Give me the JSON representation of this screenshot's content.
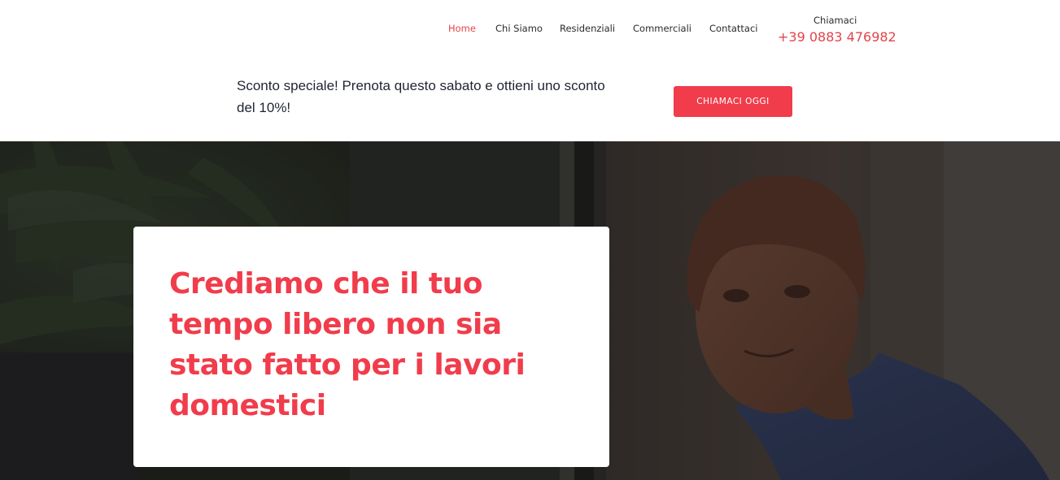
{
  "nav": {
    "items": [
      {
        "label": "Home"
      },
      {
        "label": "Chi Siamo"
      },
      {
        "label": "Residenziali"
      },
      {
        "label": "Commerciali"
      },
      {
        "label": "Contattaci"
      }
    ],
    "active_index": 0
  },
  "call": {
    "label": "Chiamaci",
    "phone": "+39 0883 476982"
  },
  "promo": {
    "text": "Sconto speciale! Prenota questo sabato e ottieni uno sconto del 10%!",
    "button_label": "CHIAMACI OGGI"
  },
  "hero": {
    "title": "Crediamo che il tuo tempo libero non sia stato fatto per i lavori domestici",
    "image_icon": "man-portrait-photo"
  },
  "colors": {
    "accent": "#f13c4b",
    "nav_active": "#e2444a",
    "text_dark": "#1f2433",
    "hero_overlay": "#1a1817"
  }
}
